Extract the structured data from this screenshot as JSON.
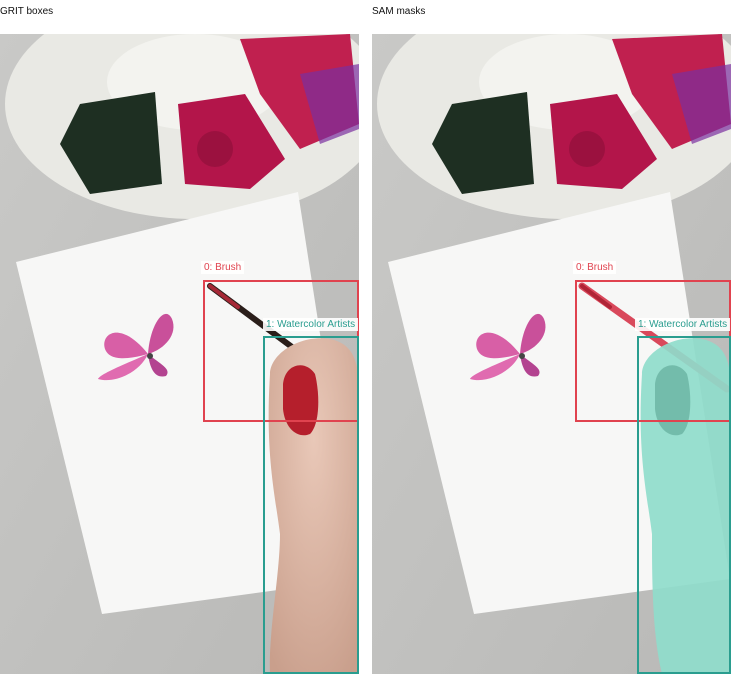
{
  "panels": {
    "left": {
      "title": "GRIT boxes"
    },
    "right": {
      "title": "SAM masks"
    }
  },
  "detections": [
    {
      "id": 0,
      "label": "0: Brush",
      "color": "#e0434f"
    },
    {
      "id": 1,
      "label": "1: Watercolor Artists",
      "color": "#2a9d8f"
    }
  ],
  "colors": {
    "brush_box": "#e0434f",
    "artist_box": "#2a9d8f",
    "artist_mask": "#7fd6c5",
    "brush_mask": "#e05a6a"
  }
}
